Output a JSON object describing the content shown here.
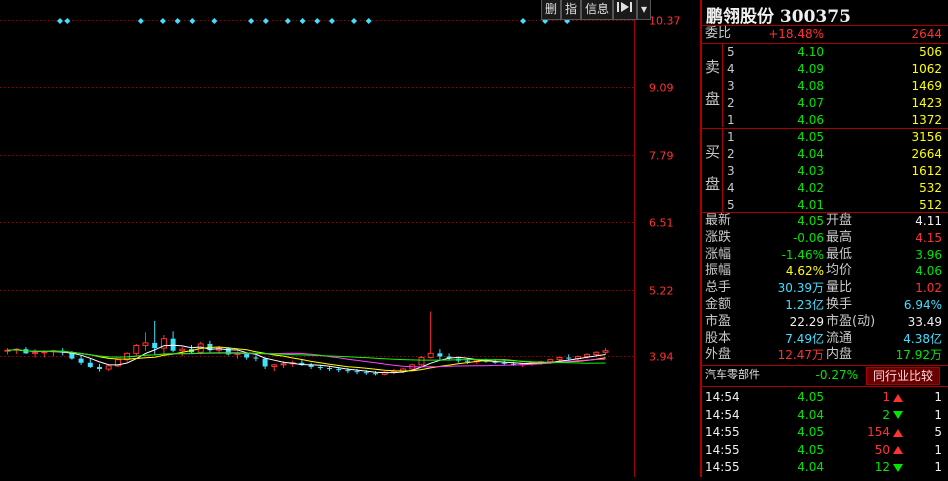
{
  "toolbar": {
    "delete_label": "删",
    "indicator_label": "指",
    "info_label": "信息",
    "menu_label": "▾"
  },
  "price_axis": {
    "labels": [
      "10.37",
      "9.09",
      "7.79",
      "6.51",
      "5.22",
      "3.94"
    ]
  },
  "chart_data": {
    "type": "candlestick",
    "title": "",
    "yticks": [
      10.37,
      9.09,
      7.79,
      6.51,
      5.22,
      3.94
    ],
    "ylim": [
      2.65,
      10.37
    ],
    "ohlc": [
      [
        4.05,
        4.1,
        3.98,
        4.06
      ],
      [
        4.06,
        4.1,
        3.99,
        4.08
      ],
      [
        4.08,
        4.12,
        3.99,
        4.0
      ],
      [
        4.0,
        4.08,
        3.92,
        4.02
      ],
      [
        4.02,
        4.06,
        3.92,
        4.03
      ],
      [
        4.03,
        4.07,
        3.95,
        4.05
      ],
      [
        4.05,
        4.1,
        3.96,
        4.02
      ],
      [
        4.02,
        4.04,
        3.88,
        3.9
      ],
      [
        3.9,
        3.96,
        3.78,
        3.82
      ],
      [
        3.82,
        3.9,
        3.72,
        3.74
      ],
      [
        3.74,
        3.8,
        3.65,
        3.7
      ],
      [
        3.7,
        3.78,
        3.66,
        3.76
      ],
      [
        3.76,
        3.9,
        3.74,
        3.88
      ],
      [
        3.88,
        4.02,
        3.84,
        4.0
      ],
      [
        4.0,
        4.18,
        3.96,
        4.15
      ],
      [
        4.15,
        4.4,
        4.05,
        4.2
      ],
      [
        4.2,
        4.62,
        3.98,
        4.1
      ],
      [
        4.1,
        4.35,
        3.96,
        4.28
      ],
      [
        4.28,
        4.42,
        4.02,
        4.05
      ],
      [
        4.05,
        4.12,
        3.95,
        4.08
      ],
      [
        4.08,
        4.16,
        3.99,
        4.02
      ],
      [
        4.02,
        4.22,
        3.98,
        4.18
      ],
      [
        4.18,
        4.24,
        4.02,
        4.06
      ],
      [
        4.06,
        4.14,
        3.99,
        4.1
      ],
      [
        4.1,
        4.12,
        3.96,
        3.98
      ],
      [
        3.98,
        4.04,
        3.9,
        4.0
      ],
      [
        4.0,
        4.02,
        3.88,
        3.92
      ],
      [
        3.92,
        3.96,
        3.85,
        3.9
      ],
      [
        3.9,
        3.92,
        3.7,
        3.75
      ],
      [
        3.75,
        3.8,
        3.66,
        3.78
      ],
      [
        3.78,
        3.85,
        3.72,
        3.8
      ],
      [
        3.8,
        3.86,
        3.74,
        3.82
      ],
      [
        3.82,
        3.88,
        3.76,
        3.78
      ],
      [
        3.78,
        3.82,
        3.7,
        3.74
      ],
      [
        3.74,
        3.78,
        3.68,
        3.72
      ],
      [
        3.72,
        3.76,
        3.66,
        3.7
      ],
      [
        3.7,
        3.74,
        3.64,
        3.68
      ],
      [
        3.68,
        3.72,
        3.62,
        3.66
      ],
      [
        3.66,
        3.7,
        3.6,
        3.64
      ],
      [
        3.64,
        3.68,
        3.59,
        3.62
      ],
      [
        3.62,
        3.66,
        3.58,
        3.6
      ],
      [
        3.6,
        3.66,
        3.58,
        3.64
      ],
      [
        3.64,
        3.7,
        3.6,
        3.66
      ],
      [
        3.66,
        3.72,
        3.62,
        3.7
      ],
      [
        3.7,
        3.8,
        3.66,
        3.78
      ],
      [
        3.78,
        3.95,
        3.76,
        3.92
      ],
      [
        3.92,
        4.8,
        3.9,
        4.0
      ],
      [
        4.0,
        4.08,
        3.88,
        3.94
      ],
      [
        3.94,
        4.0,
        3.86,
        3.9
      ],
      [
        3.9,
        3.94,
        3.82,
        3.86
      ],
      [
        3.86,
        3.9,
        3.8,
        3.84
      ],
      [
        3.84,
        3.88,
        3.8,
        3.86
      ],
      [
        3.86,
        3.9,
        3.82,
        3.84
      ],
      [
        3.84,
        3.88,
        3.8,
        3.82
      ],
      [
        3.82,
        3.86,
        3.78,
        3.8
      ],
      [
        3.8,
        3.84,
        3.76,
        3.78
      ],
      [
        3.78,
        3.82,
        3.74,
        3.8
      ],
      [
        3.8,
        3.84,
        3.76,
        3.82
      ],
      [
        3.82,
        3.86,
        3.78,
        3.84
      ],
      [
        3.84,
        3.9,
        3.8,
        3.88
      ],
      [
        3.88,
        3.94,
        3.84,
        3.92
      ],
      [
        3.92,
        3.98,
        3.86,
        3.9
      ],
      [
        3.9,
        3.96,
        3.86,
        3.94
      ],
      [
        3.94,
        4.0,
        3.9,
        3.98
      ],
      [
        3.98,
        4.04,
        3.94,
        4.02
      ],
      [
        4.02,
        4.1,
        3.98,
        4.05
      ]
    ],
    "signal_marks": [
      9,
      10,
      20,
      23,
      25,
      27,
      30,
      35,
      37,
      40,
      42,
      44,
      46,
      49,
      51,
      72,
      75,
      78
    ]
  },
  "stock": {
    "name": "鹏翎股份",
    "code": "300375"
  },
  "order_ratio": {
    "label": "委比",
    "percent": "+18.48%",
    "diff": "2644"
  },
  "sell_label": [
    "卖",
    "盘"
  ],
  "buy_label": [
    "买",
    "盘"
  ],
  "asks": [
    {
      "level": "5",
      "price": "4.10",
      "volume": "506"
    },
    {
      "level": "4",
      "price": "4.09",
      "volume": "1062"
    },
    {
      "level": "3",
      "price": "4.08",
      "volume": "1469"
    },
    {
      "level": "2",
      "price": "4.07",
      "volume": "1423"
    },
    {
      "level": "1",
      "price": "4.06",
      "volume": "1372"
    }
  ],
  "bids": [
    {
      "level": "1",
      "price": "4.05",
      "volume": "3156"
    },
    {
      "level": "2",
      "price": "4.04",
      "volume": "2664"
    },
    {
      "level": "3",
      "price": "4.03",
      "volume": "1612"
    },
    {
      "level": "4",
      "price": "4.02",
      "volume": "532"
    },
    {
      "level": "5",
      "price": "4.01",
      "volume": "512"
    }
  ],
  "quote": [
    {
      "l1": "最新",
      "v1": "4.05",
      "c1": "g",
      "l2": "开盘",
      "v2": "4.11",
      "c2": "w"
    },
    {
      "l1": "涨跌",
      "v1": "-0.06",
      "c1": "g",
      "l2": "最高",
      "v2": "4.15",
      "c2": "red"
    },
    {
      "l1": "涨幅",
      "v1": "-1.46%",
      "c1": "g",
      "l2": "最低",
      "v2": "3.96",
      "c2": "g"
    },
    {
      "l1": "振幅",
      "v1": "4.62%",
      "c1": "y",
      "l2": "均价",
      "v2": "4.06",
      "c2": "g"
    },
    {
      "l1": "总手",
      "v1": "30.39万",
      "c1": "cy",
      "l2": "量比",
      "v2": "1.02",
      "c2": "red"
    },
    {
      "l1": "金额",
      "v1": "1.23亿",
      "c1": "cy",
      "l2": "换手",
      "v2": "6.94%",
      "c2": "cy"
    },
    {
      "l1": "市盈",
      "v1": "22.29",
      "c1": "w",
      "l2": "市盈(动)",
      "v2": "33.49",
      "c2": "w"
    },
    {
      "l1": "股本",
      "v1": "7.49亿",
      "c1": "cy",
      "l2": "流通",
      "v2": "4.38亿",
      "c2": "cy"
    },
    {
      "l1": "外盘",
      "v1": "12.47万",
      "c1": "red",
      "l2": "内盘",
      "v2": "17.92万",
      "c2": "g"
    }
  ],
  "sector": {
    "name": "汽车零部件",
    "change": "-0.27%",
    "compare_label": "同行业比较"
  },
  "ticks": [
    {
      "time": "14:54",
      "price": "4.05",
      "volume": "1",
      "dir": "up",
      "count": "1"
    },
    {
      "time": "14:54",
      "price": "4.04",
      "volume": "2",
      "dir": "down",
      "count": "1"
    },
    {
      "time": "14:55",
      "price": "4.05",
      "volume": "154",
      "dir": "up",
      "count": "5"
    },
    {
      "time": "14:55",
      "price": "4.05",
      "volume": "50",
      "dir": "up",
      "count": "1"
    },
    {
      "time": "14:55",
      "price": "4.04",
      "volume": "12",
      "dir": "down",
      "count": "1"
    }
  ],
  "colors": {
    "up": "#ff3232",
    "down": "#40e0ff",
    "grid": "#a00000",
    "ma5": "#ffffff",
    "ma10": "#ffff00",
    "ma20": "#ff40ff",
    "ma60": "#00ff00",
    "signal": "#40e0ff"
  }
}
